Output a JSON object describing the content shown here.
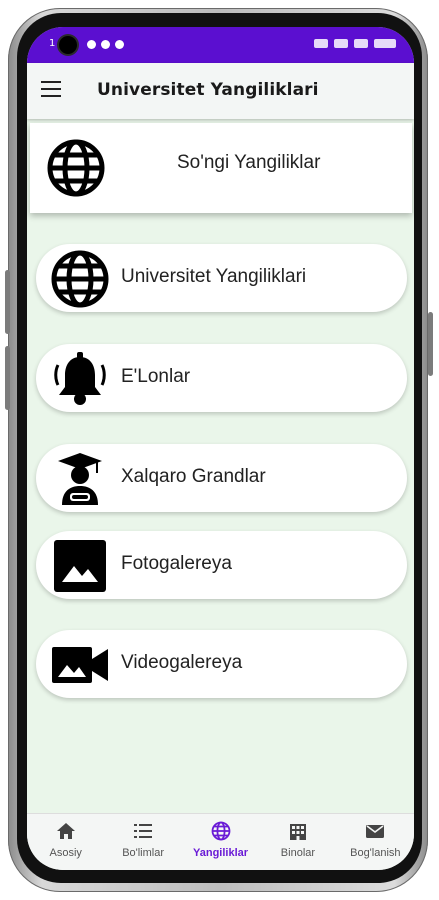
{
  "status_bar": {
    "left_text": "1"
  },
  "app_bar": {
    "title": "Universitet Yangiliklari",
    "menu_icon": "hamburger-menu-icon"
  },
  "featured": {
    "label": "So'ngi Yangiliklar",
    "icon": "globe-icon"
  },
  "menu_items": [
    {
      "label": "Universitet Yangiliklari",
      "icon": "globe-icon"
    },
    {
      "label": "E'Lonlar",
      "icon": "bell-icon"
    },
    {
      "label": "Xalqaro Grandlar",
      "icon": "graduate-icon"
    },
    {
      "label": "Fotogalereya",
      "icon": "image-icon"
    },
    {
      "label": "Videogalereya",
      "icon": "video-camera-icon"
    }
  ],
  "bottom_nav": [
    {
      "label": "Asosiy",
      "icon": "home-icon",
      "active": false
    },
    {
      "label": "Bo'limlar",
      "icon": "list-icon",
      "active": false
    },
    {
      "label": "Yangiliklar",
      "icon": "globe-icon",
      "active": true
    },
    {
      "label": "Binolar",
      "icon": "building-icon",
      "active": false
    },
    {
      "label": "Bog'lanish",
      "icon": "mail-icon",
      "active": false
    }
  ],
  "colors": {
    "status_bar": "#5b0fd0",
    "active_nav": "#6a1bd6",
    "screen_bg": "#eaf6ea"
  }
}
